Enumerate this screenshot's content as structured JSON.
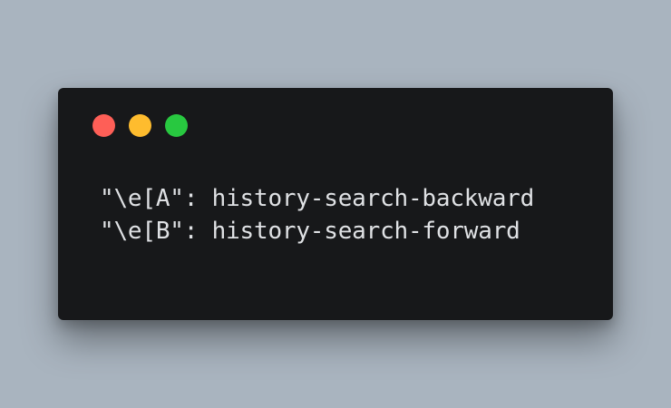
{
  "window_controls": {
    "close_color": "#fe5f57",
    "minimize_color": "#febc2e",
    "maximize_color": "#28c840"
  },
  "code": {
    "lines": [
      "\"\\e[A\": history-search-backward",
      "\"\\e[B\": history-search-forward"
    ],
    "text_color": "#dfe1e4"
  }
}
